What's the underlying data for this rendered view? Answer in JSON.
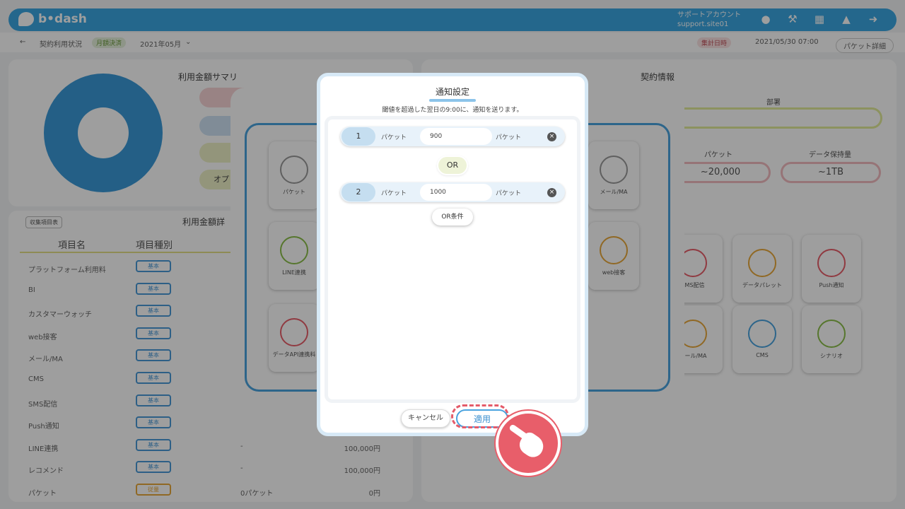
{
  "header": {
    "logo": "b•dash",
    "account_line1": "サポートアカウント",
    "account_line2": "support.site01",
    "icons": [
      "bell-icon",
      "wrench-icon",
      "grid-icon",
      "megaphone-icon",
      "logout-icon"
    ]
  },
  "subheader": {
    "back": "←",
    "title": "契約利用状況",
    "badge": "月額決済",
    "month": "2021年05月",
    "closing_label": "集計日時",
    "closing_value": "2021/05/30 07:00",
    "packet_detail": "パケット詳細"
  },
  "background": {
    "summary_title": "利用金額サマリ",
    "summary_option": "オプ",
    "table_toggle": "収集項目表",
    "table_title": "利用金額詳",
    "columns": [
      "項目名",
      "項目種別"
    ],
    "rows": [
      {
        "name": "プラットフォーム利用料",
        "type": "基本",
        "qty": "",
        "amount": ""
      },
      {
        "name": "BI",
        "type": "基本",
        "qty": "",
        "amount": ""
      },
      {
        "name": "カスタマーウォッチ",
        "type": "基本",
        "qty": "",
        "amount": ""
      },
      {
        "name": "web接客",
        "type": "基本",
        "qty": "",
        "amount": ""
      },
      {
        "name": "メール/MA",
        "type": "基本",
        "qty": "",
        "amount": ""
      },
      {
        "name": "CMS",
        "type": "基本",
        "qty": "",
        "amount": ""
      },
      {
        "name": "SMS配信",
        "type": "基本",
        "qty": "",
        "amount": ""
      },
      {
        "name": "Push通知",
        "type": "基本",
        "qty": "",
        "amount": ""
      },
      {
        "name": "LINE連携",
        "type": "基本",
        "qty": "-",
        "amount": "100,000円"
      },
      {
        "name": "レコメンド",
        "type": "基本",
        "qty": "-",
        "amount": "100,000円"
      },
      {
        "name": "パケット",
        "type": "従量",
        "qty": "0パケット",
        "amount": "0円"
      }
    ],
    "contract_title": "契約情報",
    "contract_plan_label": "部署",
    "contract_packet_label": "パケット",
    "contract_packet_value": "~20,000",
    "contract_storage_label": "データ保持量",
    "contract_storage_value": "~1TB",
    "tiles_left": [
      "パケット",
      "LINE連携",
      "データAPI連携料"
    ],
    "tiles_mid": [
      "メール/MA",
      "web接客"
    ],
    "tiles_right": [
      "SMS配信",
      "データパレット",
      "Push通知",
      "メール/MA",
      "CMS",
      "シナリオ"
    ]
  },
  "modal": {
    "title": "通知設定",
    "description": "閾値を超過した翌日の9:00に、通知を送ります。",
    "conditions": [
      {
        "index": "1",
        "label_left": "パケット",
        "value": "900",
        "label_right": "パケット"
      },
      {
        "index": "2",
        "label_left": "パケット",
        "value": "1000",
        "label_right": "パケット"
      }
    ],
    "or_label": "OR",
    "or_add_label": "OR条件",
    "cancel_label": "キャンセル",
    "apply_label": "適用"
  },
  "colors": {
    "brand": "#3aa7e3",
    "accent_red": "#e85e6a",
    "apply_border": "#4aa3df"
  }
}
